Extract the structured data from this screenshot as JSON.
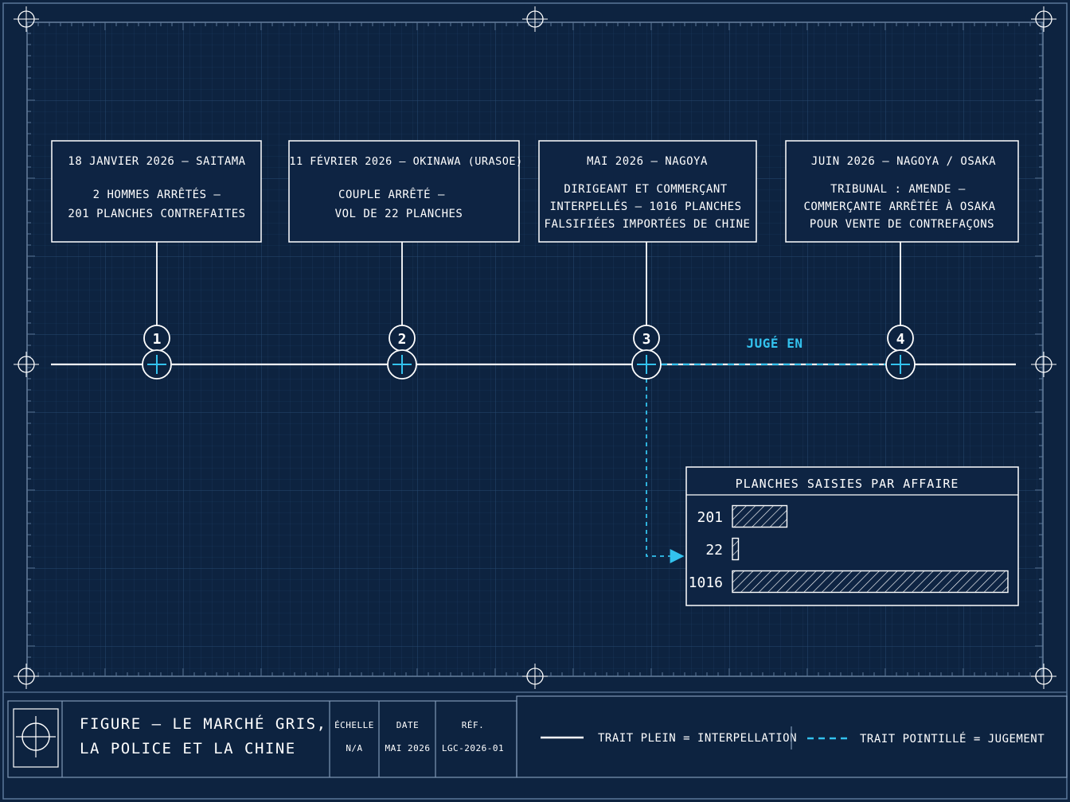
{
  "colors": {
    "background": "#0d2340",
    "panel": "#0e2443",
    "line": "#ffffff",
    "accent": "#33c2ee",
    "grid_minor": "#1c3b60",
    "grid_major": "#27496f"
  },
  "timeline": {
    "events": [
      {
        "number": "1",
        "title": "18 JANVIER 2026 — SAITAMA",
        "lines": [
          "2 HOMMES ARRÊTÉS —",
          "201 PLANCHES CONTREFAITES"
        ]
      },
      {
        "number": "2",
        "title": "11 FÉVRIER 2026 — OKINAWA (URASOE)",
        "lines": [
          "COUPLE ARRÊTÉ —",
          "VOL DE 22 PLANCHES"
        ]
      },
      {
        "number": "3",
        "title": "MAI 2026 — NAGOYA",
        "lines": [
          "DIRIGEANT ET COMMERÇANT",
          "INTERPELLÉS — 1016 PLANCHES",
          "FALSIFIÉES IMPORTÉES DE CHINE"
        ]
      },
      {
        "number": "4",
        "title": "JUIN 2026 — NAGOYA / OSAKA",
        "lines": [
          "TRIBUNAL : AMENDE —",
          "COMMERÇANTE ARRÊTÉE À OSAKA",
          "POUR VENTE DE CONTREFAÇONS"
        ]
      }
    ],
    "judged_label": "JUGÉ EN"
  },
  "chart_data": {
    "type": "bar",
    "title": "PLANCHES SAISIES PAR AFFAIRE",
    "categories": [
      "201",
      "22",
      "1016"
    ],
    "values": [
      201,
      22,
      1016
    ],
    "xlim": [
      0,
      1016
    ],
    "legend": "none",
    "grid": false
  },
  "title_block": {
    "title_lines": [
      "FIGURE — LE MARCHÉ GRIS,",
      "LA POLICE ET LA CHINE"
    ],
    "scale_label": "ÉCHELLE",
    "scale_value": "N/A",
    "date_label": "DATE",
    "date_value": "MAI 2026",
    "ref_label": "RÉF.",
    "ref_value": "LGC-2026-01"
  },
  "legend": {
    "solid": "TRAIT PLEIN = INTERPELLATION",
    "dashed": "TRAIT POINTILLÉ = JUGEMENT"
  },
  "icons": {
    "registration_mark": "crosshair-circle-icon",
    "timeline_node": "plus-circle-icon",
    "logo": "target-crosshair-icon"
  }
}
